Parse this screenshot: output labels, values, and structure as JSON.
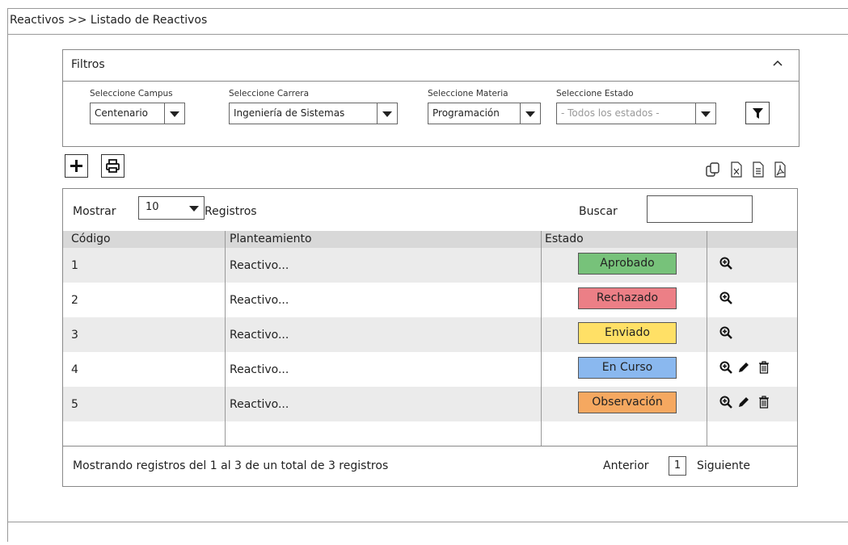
{
  "breadcrumb": "Reactivos >> Listado de Reactivos",
  "filters": {
    "title": "Filtros",
    "collapse_icon": "chevron-up-icon",
    "campus": {
      "label": "Seleccione Campus",
      "value": "Centenario"
    },
    "career": {
      "label": "Seleccione Carrera",
      "value": "Ingeniería de Sistemas"
    },
    "subject": {
      "label": "Seleccione Materia",
      "value": "Programación"
    },
    "state": {
      "label": "Seleccione Estado",
      "placeholder": "- Todos los estados -"
    },
    "apply_icon": "filter-icon"
  },
  "toolbar": {
    "add_icon": "plus-icon",
    "print_icon": "printer-icon",
    "export_icons": [
      "copy-icon",
      "excel-icon",
      "text-file-icon",
      "pdf-icon"
    ]
  },
  "table": {
    "show_label": "Mostrar",
    "page_size": "10",
    "records_label": "Registros",
    "search_label": "Buscar",
    "columns": [
      "Código",
      "Planteamiento",
      "Estado",
      ""
    ],
    "rows": [
      {
        "code": "1",
        "statement": "Reactivo...",
        "status": "Aprobado",
        "color": "#77c27a",
        "actions": [
          "view"
        ]
      },
      {
        "code": "2",
        "statement": "Reactivo...",
        "status": "Rechazado",
        "color": "#ec7f86",
        "actions": [
          "view"
        ]
      },
      {
        "code": "3",
        "statement": "Reactivo...",
        "status": "Enviado",
        "color": "#ffe066",
        "actions": [
          "view"
        ]
      },
      {
        "code": "4",
        "statement": "Reactivo...",
        "status": "En Curso",
        "color": "#8ab8ef",
        "actions": [
          "view",
          "edit",
          "delete"
        ]
      },
      {
        "code": "5",
        "statement": "Reactivo...",
        "status": "Observación",
        "color": "#f5a860",
        "actions": [
          "view",
          "edit",
          "delete"
        ]
      }
    ],
    "footer_text": "Mostrando registros del 1 al 3 de un total de 3 registros",
    "prev_label": "Anterior",
    "page": "1",
    "next_label": "Siguiente"
  }
}
